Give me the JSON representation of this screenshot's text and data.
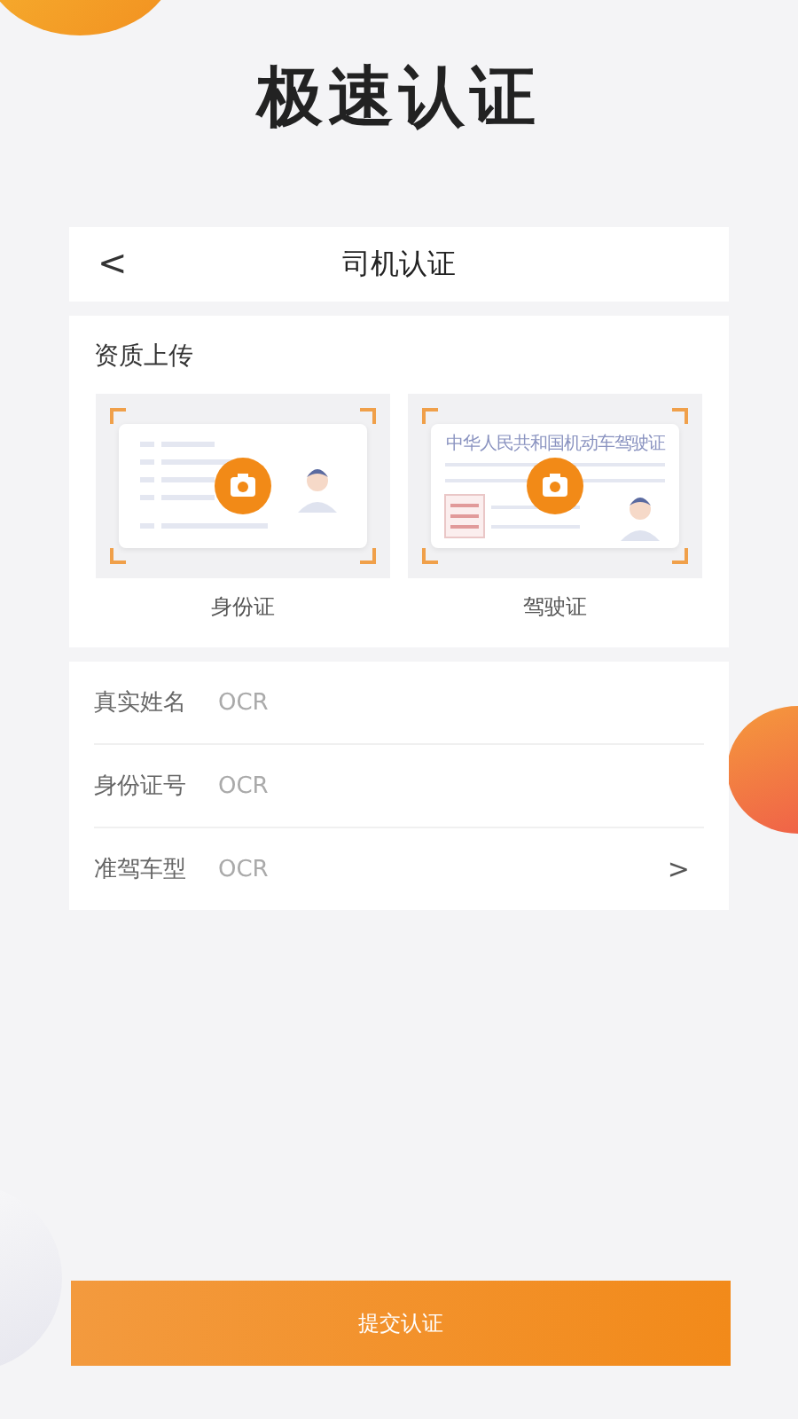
{
  "headline": "极速认证",
  "nav": {
    "back": "<",
    "title": "司机认证"
  },
  "upload": {
    "title": "资质上传",
    "cards": [
      {
        "kind": "id",
        "label": "身份证"
      },
      {
        "kind": "license",
        "label": "驾驶证",
        "card_heading": "中华人民共和国机动车驾驶证"
      }
    ]
  },
  "fields": [
    {
      "kind": "text",
      "label": "真实姓名",
      "placeholder": "OCR"
    },
    {
      "kind": "text",
      "label": "身份证号",
      "placeholder": "OCR"
    },
    {
      "kind": "select",
      "label": "准驾车型",
      "placeholder": "OCR",
      "chevron": ">"
    }
  ],
  "submit": "提交认证"
}
